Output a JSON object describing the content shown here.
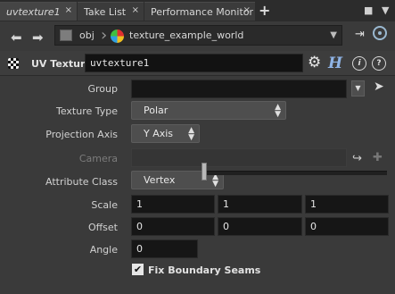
{
  "tabs": [
    {
      "label": "uvtexture1",
      "active": true
    },
    {
      "label": "Take List",
      "active": false
    },
    {
      "label": "Performance Monitor",
      "active": false
    }
  ],
  "tab_close_glyph": "×",
  "new_tab_glyph": "+",
  "path": {
    "root": "obj",
    "node": "texture_example_world"
  },
  "node": {
    "type": "UV Texture",
    "name": "uvtexture1"
  },
  "params": {
    "group": {
      "label": "Group",
      "value": ""
    },
    "texture_type": {
      "label": "Texture Type",
      "value": "Polar"
    },
    "projection_axis": {
      "label": "Projection Axis",
      "value": "Y Axis"
    },
    "camera": {
      "label": "Camera",
      "value": ""
    },
    "attribute_class": {
      "label": "Attribute Class",
      "value": "Vertex"
    },
    "scale": {
      "label": "Scale",
      "x": "1",
      "y": "1",
      "z": "1"
    },
    "offset": {
      "label": "Offset",
      "x": "0",
      "y": "0",
      "z": "0"
    },
    "angle": {
      "label": "Angle",
      "value": "0",
      "slider_fraction": 0.0
    },
    "fix_boundary_seams": {
      "label": "Fix Boundary Seams",
      "checked": true
    }
  }
}
